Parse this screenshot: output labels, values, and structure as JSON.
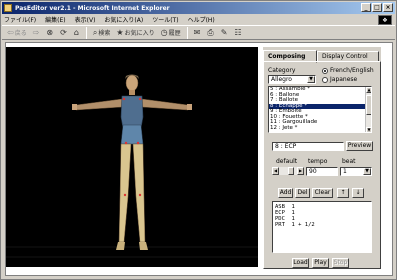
{
  "window": {
    "title": "PasEditor ver2.1 - Microsoft Internet Explorer",
    "brand": "❖"
  },
  "menubar": [
    "ファイル(F)",
    "編集(E)",
    "表示(V)",
    "お気に入り(A)",
    "ツール(T)",
    "ヘルプ(H)"
  ],
  "toolbar": {
    "back": "戻る",
    "search": "検索",
    "favorites": "お気に入り",
    "history": "履歴"
  },
  "panel": {
    "tabs": [
      "Composing",
      "Display Control"
    ],
    "category_label": "Category",
    "category_value": "Allegro",
    "lang_options": [
      "French/English",
      "Japanese"
    ],
    "lang_selected": 0,
    "moves": [
      "5 : Assamble *",
      "6 : Ballone",
      "7 : Ballote",
      "8 : Echappe *",
      "9 : Emboite",
      "10 : Fouette *",
      "11 : Gargouillade",
      "12 : Jete *"
    ],
    "moves_selected": 3,
    "current_move": "8 : ECP",
    "preview_label": "Preview",
    "default_label": "default",
    "tempo_label": "tempo",
    "beat_label": "beat",
    "tempo_value": "90",
    "beat_value": "1",
    "buttons": {
      "add": "Add",
      "del": "Del",
      "clear": "Clear",
      "up": "↑",
      "down": "↓",
      "load": "Load",
      "play": "Play",
      "stop": "Stop"
    },
    "sequence": [
      "ASB  1",
      "ECP  1",
      "PDC  1",
      "PRT  1 + 1/2"
    ]
  }
}
